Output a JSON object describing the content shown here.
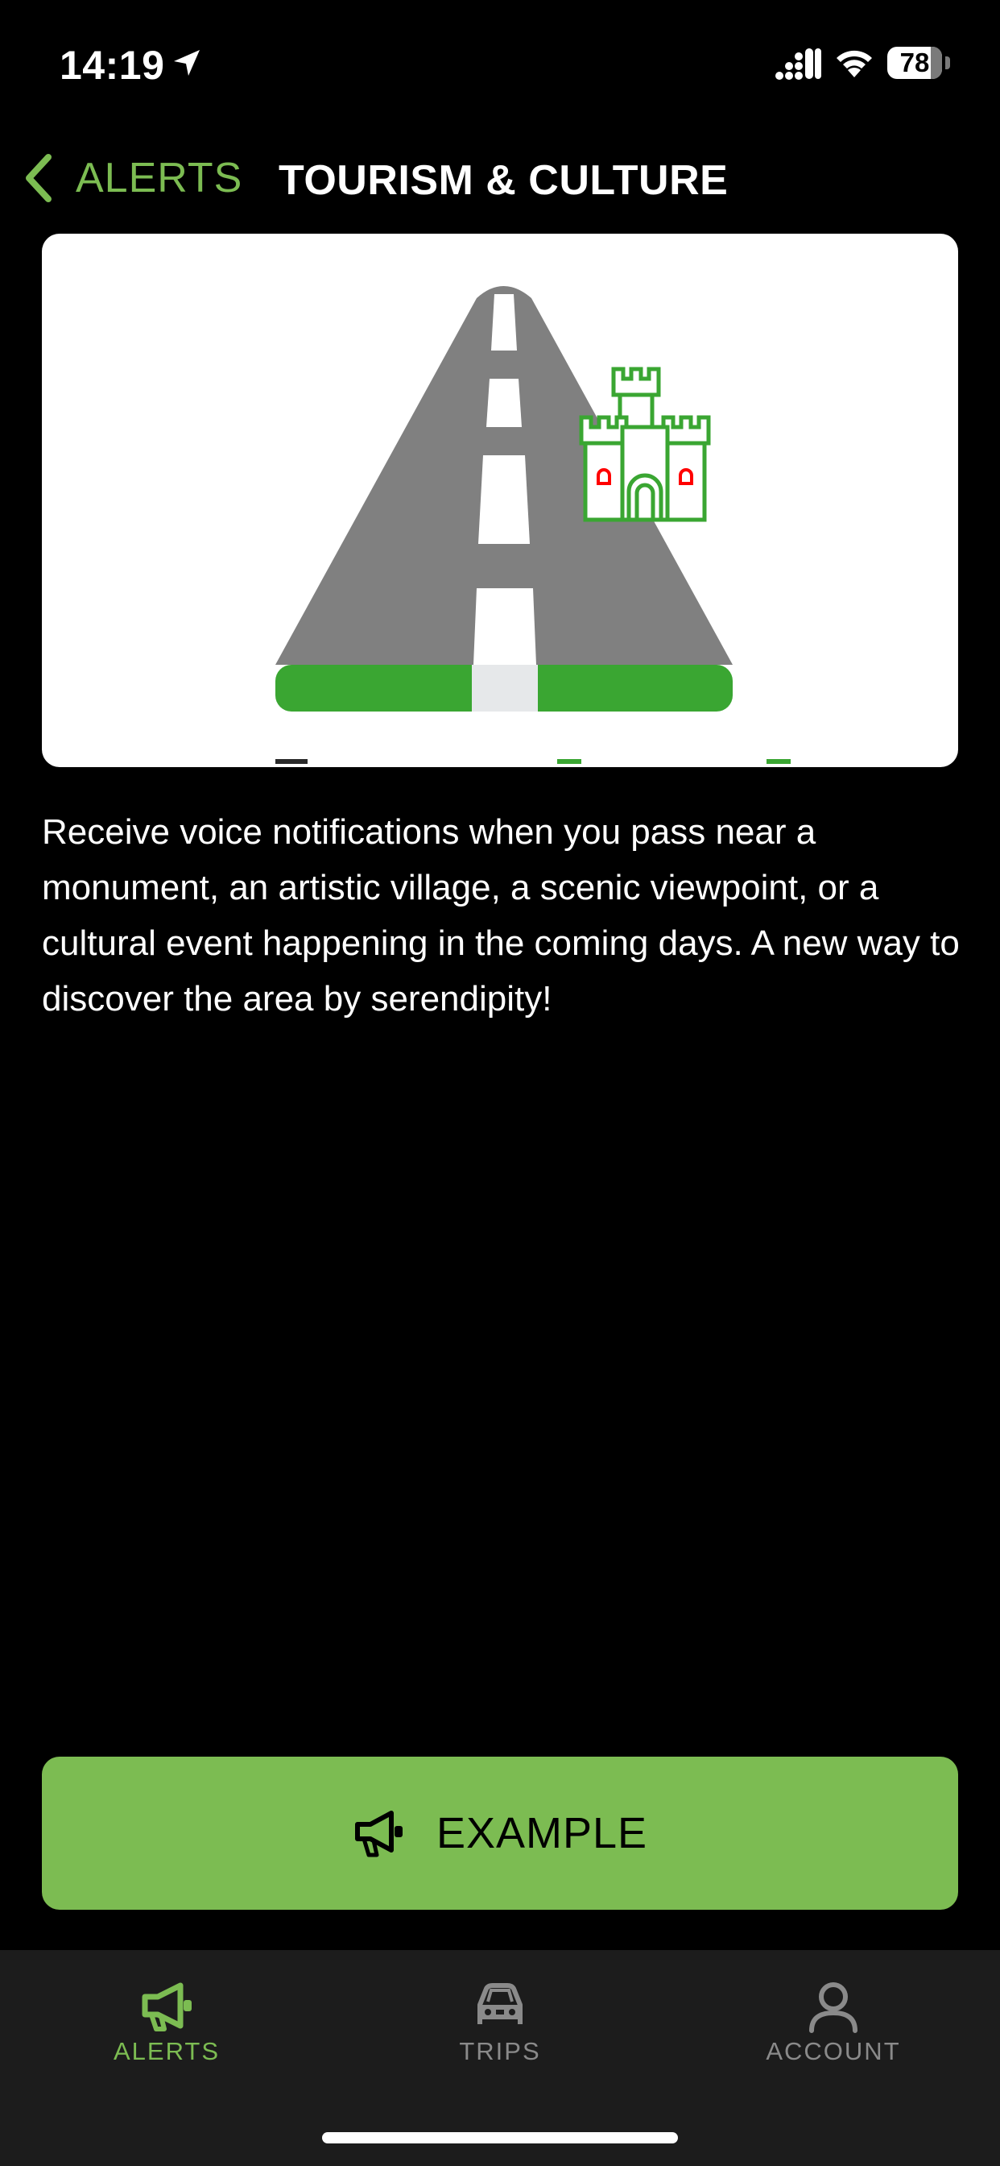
{
  "status_bar": {
    "time": "14:19",
    "battery": "78",
    "icons": [
      "location-arrow-icon",
      "cellular-signal-icon",
      "wifi-icon",
      "battery-icon"
    ]
  },
  "nav": {
    "back_label": "ALERTS",
    "title": "TOURISM & CULTURE"
  },
  "illustration": {
    "subject": "road-with-castle",
    "colors": {
      "road": "#808080",
      "green": "#3aa632",
      "castle": "#3aa632",
      "castle_window": "#ff0000"
    }
  },
  "description": "Receive voice notifications when you pass near a monument, an artistic village, a scenic viewpoint, or a cultural event happening in the coming days. A new way to discover the area by serendipity!",
  "example_button": {
    "label": "EXAMPLE",
    "icon": "megaphone-icon"
  },
  "tabbar": {
    "tabs": [
      {
        "label": "ALERTS",
        "icon": "megaphone-icon",
        "active": true
      },
      {
        "label": "TRIPS",
        "icon": "car-icon",
        "active": false
      },
      {
        "label": "ACCOUNT",
        "icon": "person-icon",
        "active": false
      }
    ]
  },
  "colors": {
    "accent": "#7cbc52",
    "background": "#000000",
    "tabbar_bg": "#1c1c1c",
    "inactive": "#8a8a8a"
  }
}
